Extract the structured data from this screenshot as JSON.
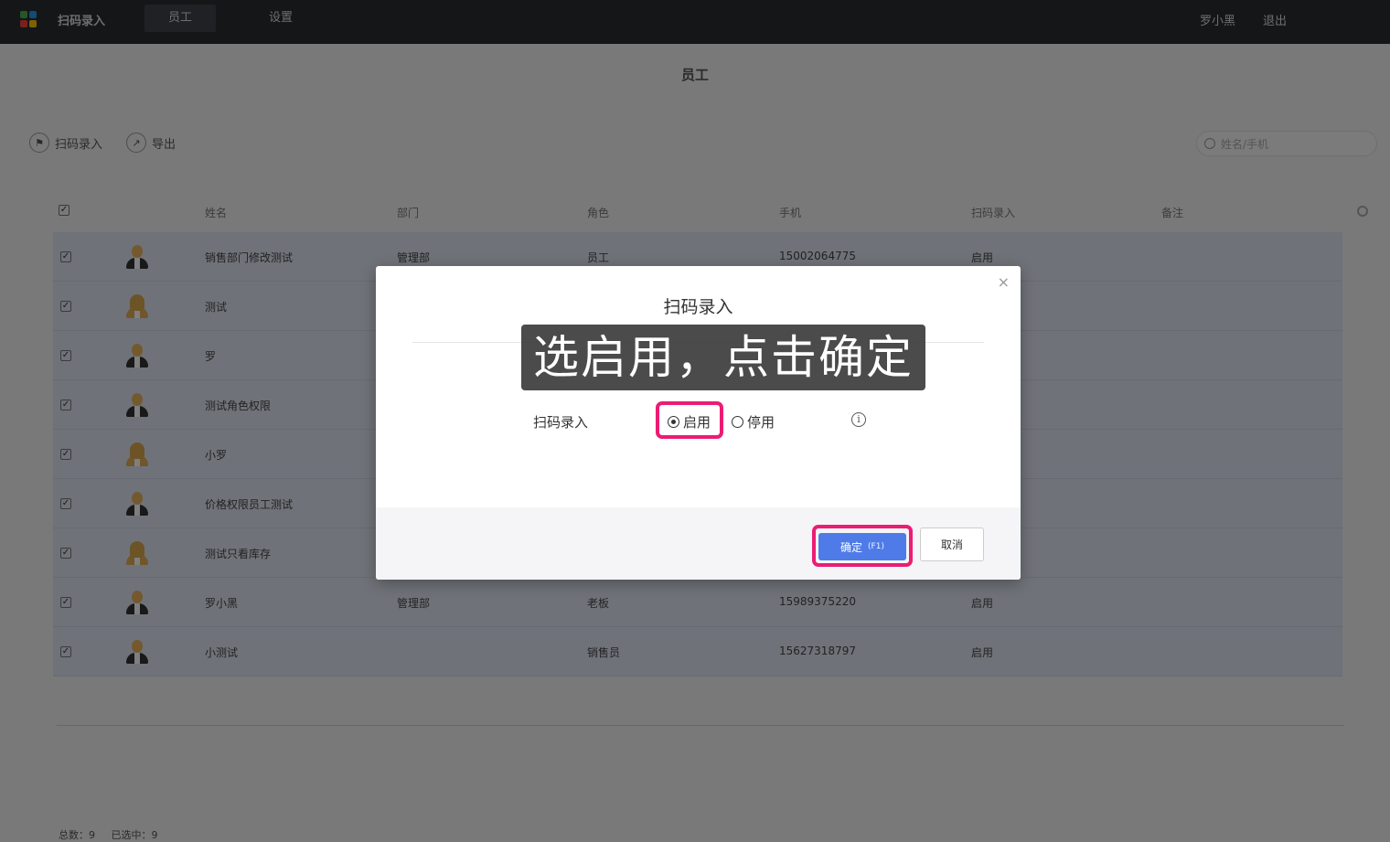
{
  "topbar": {
    "app_title": "扫码录入",
    "nav": [
      "员工",
      "设置"
    ],
    "user": "罗小黑",
    "logout": "退出"
  },
  "page": {
    "title": "员工",
    "toolbar": {
      "scan_label": "扫码录入",
      "export_label": "导出"
    },
    "search_placeholder": "姓名/手机"
  },
  "table": {
    "columns": [
      "姓名",
      "部门",
      "角色",
      "手机",
      "扫码录入",
      "备注"
    ],
    "rows": [
      {
        "name": "销售部门修改测试",
        "dept": "管理部",
        "role": "员工",
        "phone": "15002064775",
        "scan": "启用",
        "avatar": "male"
      },
      {
        "name": "测试",
        "dept": "",
        "role": "",
        "phone": "",
        "scan": "",
        "avatar": "female"
      },
      {
        "name": "罗",
        "dept": "",
        "role": "",
        "phone": "",
        "scan": "",
        "avatar": "male"
      },
      {
        "name": "测试角色权限",
        "dept": "",
        "role": "",
        "phone": "",
        "scan": "",
        "avatar": "male"
      },
      {
        "name": "小罗",
        "dept": "",
        "role": "",
        "phone": "",
        "scan": "",
        "avatar": "female"
      },
      {
        "name": "价格权限员工测试",
        "dept": "",
        "role": "",
        "phone": "",
        "scan": "",
        "avatar": "male"
      },
      {
        "name": "测试只看库存",
        "dept": "",
        "role": "",
        "phone": "",
        "scan": "",
        "avatar": "female"
      },
      {
        "name": "罗小黑",
        "dept": "管理部",
        "role": "老板",
        "phone": "15989375220",
        "scan": "启用",
        "avatar": "male"
      },
      {
        "name": "小测试",
        "dept": "",
        "role": "销售员",
        "phone": "15627318797",
        "scan": "启用",
        "avatar": "male"
      }
    ]
  },
  "footer": {
    "total_label": "总数：",
    "total": "9",
    "selected_label": "已选中：",
    "selected": "9"
  },
  "modal": {
    "title": "扫码录入",
    "close": "×",
    "field_label": "扫码录入",
    "options": [
      "启用",
      "停用"
    ],
    "selected": "启用",
    "info": "i",
    "ok_label": "确定",
    "ok_shortcut": "(F1)",
    "cancel_label": "取消"
  },
  "caption": "选启用，点击确定",
  "colors": {
    "highlight": "#ec1c74",
    "primary": "#4f7be8",
    "topbar": "#2b2d31"
  }
}
